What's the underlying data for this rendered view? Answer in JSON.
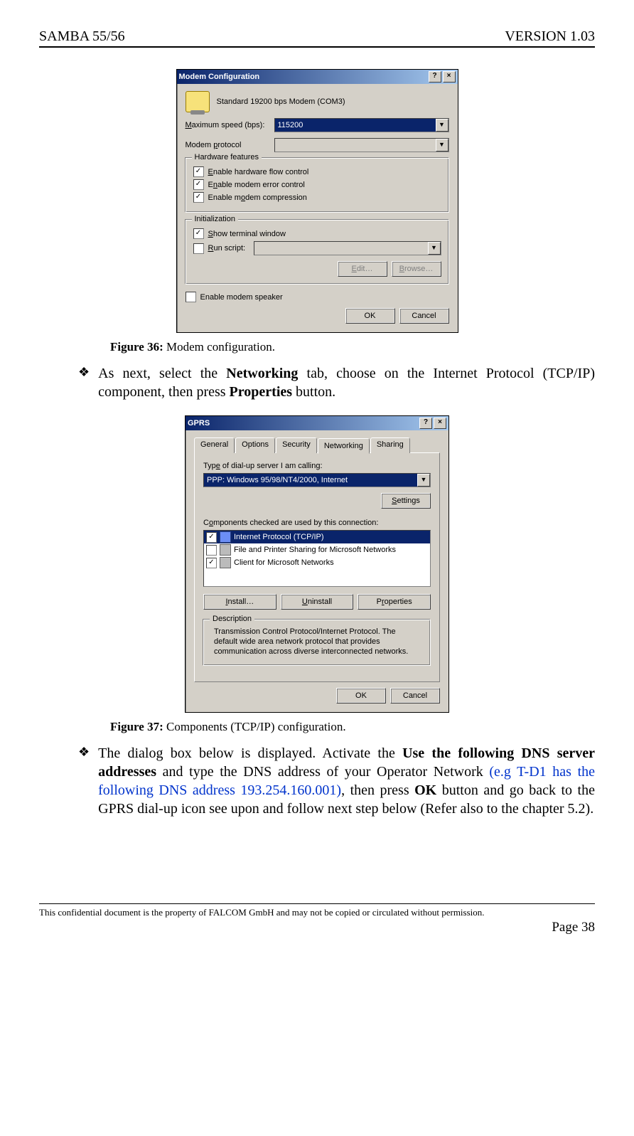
{
  "header": {
    "left": "SAMBA 55/56",
    "right": "VERSION 1.03"
  },
  "dialog1": {
    "title": "Modem Configuration",
    "modem_name": "Standard 19200 bps Modem (COM3)",
    "maxspeed_label": "Maximum speed (bps):",
    "maxspeed_value": "115200",
    "protocol_label": "Modem protocol",
    "protocol_value": "",
    "hardware_legend": "Hardware features",
    "hw_flow": "Enable hardware flow control",
    "hw_error": "Enable modem error control",
    "hw_comp": "Enable modem compression",
    "init_legend": "Initialization",
    "show_terminal": "Show terminal window",
    "run_script": "Run script:",
    "edit_btn": "Edit…",
    "browse_btn": "Browse…",
    "speaker": "Enable modem speaker",
    "ok": "OK",
    "cancel": "Cancel"
  },
  "caption1_prefix": "Figure 36: ",
  "caption1_text": "Modem configuration.",
  "bullet1": {
    "p1": "As next, select the ",
    "b1": "Networking",
    "p2": " tab, choose on the Internet Protocol (TCP/IP) component, then press ",
    "b2": "Properties",
    "p3": " button."
  },
  "dialog2": {
    "title": "GPRS",
    "tabs": {
      "general": "General",
      "options": "Options",
      "security": "Security",
      "networking": "Networking",
      "sharing": "Sharing"
    },
    "type_label": "Type of dial-up server I am calling:",
    "type_value": "PPP: Windows 95/98/NT4/2000, Internet",
    "settings_btn": "Settings",
    "components_label": "Components checked are used by this connection:",
    "comp_tcpip": "Internet Protocol (TCP/IP)",
    "comp_fileprint": "File and Printer Sharing for Microsoft Networks",
    "comp_client": "Client for Microsoft Networks",
    "install_btn": "Install…",
    "uninstall_btn": "Uninstall",
    "properties_btn": "Properties",
    "desc_legend": "Description",
    "desc_text": "Transmission Control Protocol/Internet Protocol. The default wide area network protocol that provides communication across diverse interconnected networks.",
    "ok": "OK",
    "cancel": "Cancel"
  },
  "caption2_prefix": "Figure 37: ",
  "caption2_text": "Components (TCP/IP) configuration.",
  "bullet2": {
    "p1": "The dialog box below is displayed. Activate the ",
    "b1": "Use the following DNS server addresses",
    "p2": " and type the DNS address of your Operator Network ",
    "blue": "(e.g  T-D1 has the following DNS address 193.254.160.001)",
    "p3": ", then press ",
    "b2": "OK",
    "p4": " button and go back to the GPRS dial-up icon see upon and follow next step below (Refer also to the chapter 5.2)."
  },
  "footer": {
    "confidential": "This confidential document is the property of FALCOM GmbH and may not be copied or circulated without permission.",
    "page": "Page 38"
  }
}
